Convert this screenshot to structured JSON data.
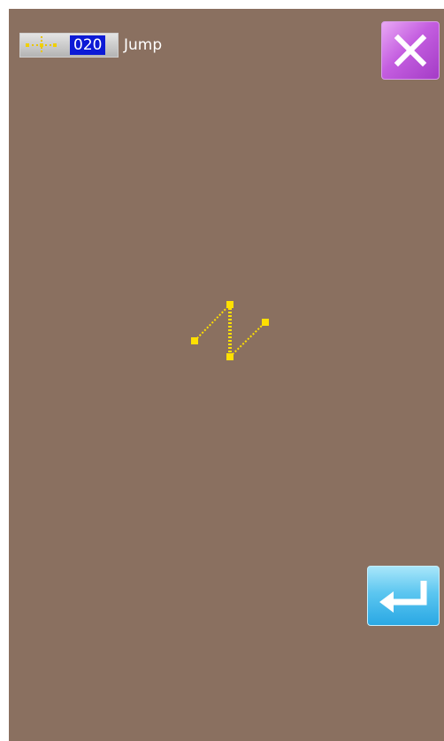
{
  "header": {
    "stitch_number": "020",
    "mode_label": "Jump"
  },
  "icons": {
    "stitch_type": "jump-stitch-icon",
    "close": "close-icon",
    "enter": "enter-return-icon"
  },
  "colors": {
    "background": "#8a7060",
    "stitch_number_bg": "#0c1ad6",
    "pattern": "#ffe000",
    "close_button": "#c45ee0",
    "enter_button": "#5cc6f0"
  }
}
